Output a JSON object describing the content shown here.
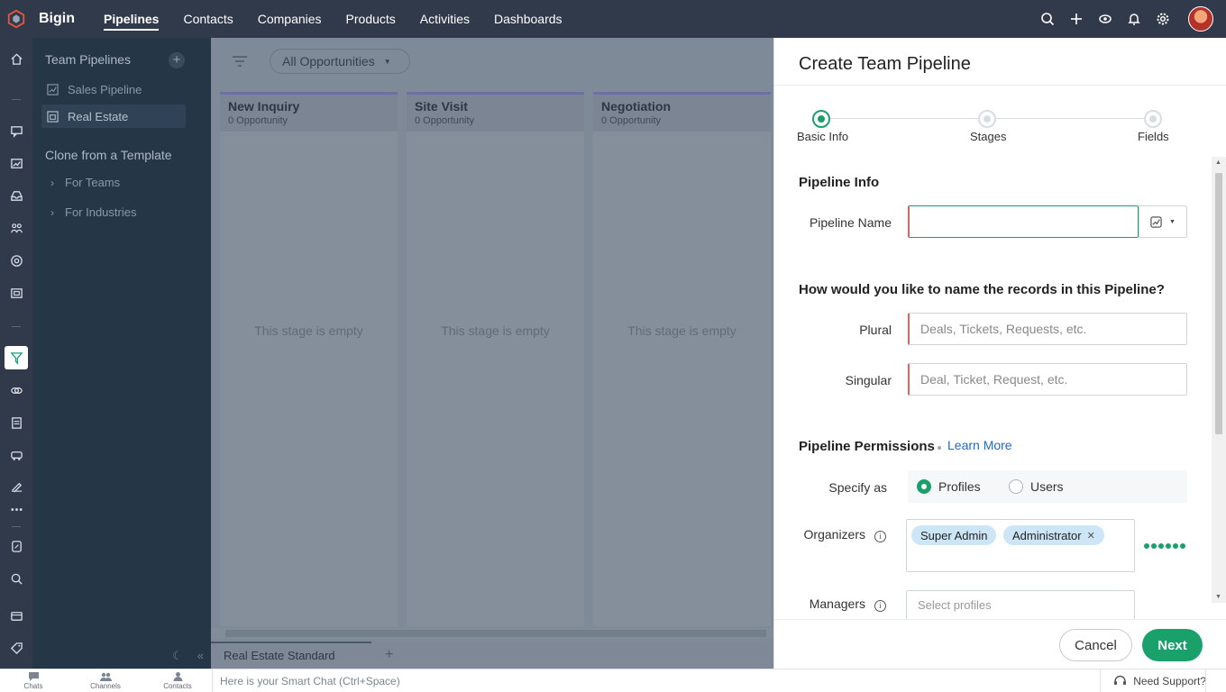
{
  "app": {
    "brand": "Bigin",
    "nav": [
      "Pipelines",
      "Contacts",
      "Companies",
      "Products",
      "Activities",
      "Dashboards"
    ],
    "active_nav": "Pipelines",
    "accent": "#1aa06b"
  },
  "sidebar": {
    "team_pipelines_title": "Team Pipelines",
    "pipelines": [
      "Sales Pipeline",
      "Real Estate"
    ],
    "selected": "Real Estate",
    "template_title": "Clone from a Template",
    "templates": [
      "For Teams",
      "For Industries"
    ]
  },
  "board": {
    "view_selector": "All Opportunities",
    "stages": [
      {
        "name": "New Inquiry",
        "count": "0 Opportunity",
        "empty": "This stage is empty"
      },
      {
        "name": "Site Visit",
        "count": "0 Opportunity",
        "empty": "This stage is empty"
      },
      {
        "name": "Negotiation",
        "count": "0 Opportunity",
        "empty": "This stage is empty"
      }
    ],
    "tab": "Real Estate Standard"
  },
  "drawer": {
    "title": "Create Team Pipeline",
    "steps": [
      "Basic Info",
      "Stages",
      "Fields"
    ],
    "pipeline_info": {
      "title": "Pipeline Info",
      "name_label": "Pipeline Name",
      "name_value": ""
    },
    "naming": {
      "question": "How would you like to name the records in this Pipeline?",
      "plural_label": "Plural",
      "plural_placeholder": "Deals, Tickets, Requests, etc.",
      "singular_label": "Singular",
      "singular_placeholder": "Deal, Ticket, Request, etc."
    },
    "permissions": {
      "title": "Pipeline Permissions",
      "learn_more": "Learn More",
      "specify_label": "Specify as",
      "options": [
        "Profiles",
        "Users"
      ],
      "selected": "Profiles",
      "organizers_label": "Organizers",
      "organizers": [
        "Super Admin",
        "Administrator"
      ],
      "managers_label": "Managers",
      "managers_placeholder": "Select profiles"
    },
    "buttons": {
      "cancel": "Cancel",
      "next": "Next"
    }
  },
  "bottombar": {
    "items": [
      "Chats",
      "Channels",
      "Contacts"
    ],
    "smart_chat": "Here is your Smart Chat (Ctrl+Space)",
    "support": "Need Support?"
  }
}
